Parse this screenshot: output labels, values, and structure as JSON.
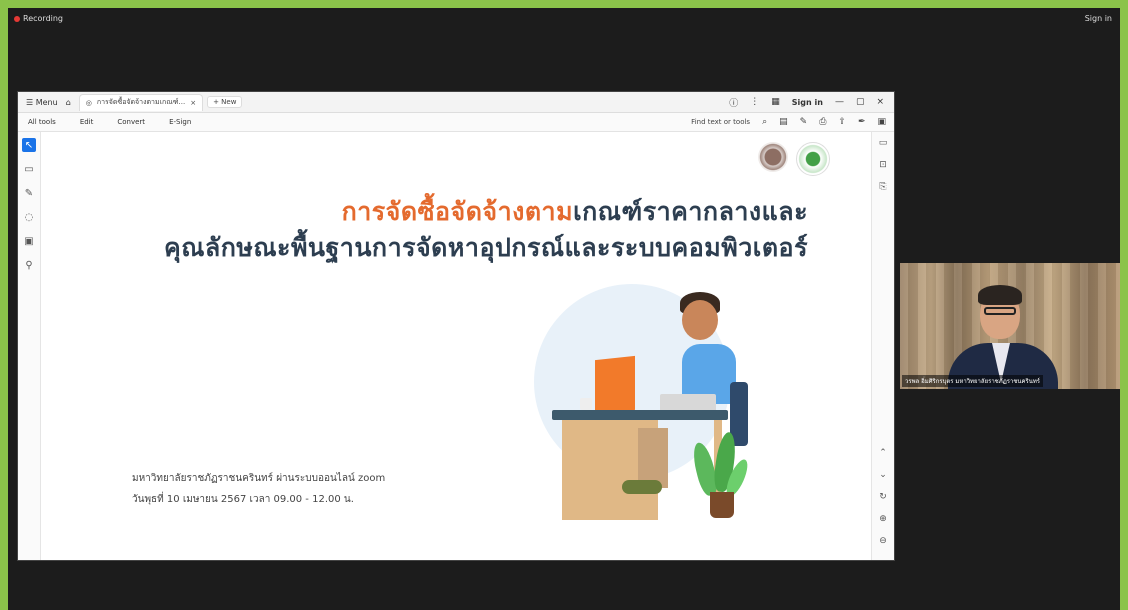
{
  "top_bar": {
    "recording": "Recording",
    "sign_in": "Sign in"
  },
  "browser": {
    "menu": "Menu",
    "tab_title": "การจัดซื้อจัดจ้างตามเกณฑ์...",
    "new_tab": "+ New",
    "sign_in": "Sign in"
  },
  "pdf_toolbar": {
    "menu_items": [
      "All tools",
      "Edit",
      "Convert",
      "E-Sign"
    ],
    "find": "Find text or tools"
  },
  "slide": {
    "title_line1_orange": "การจัดซื้อจัดจ้างตาม",
    "title_line1_dark": "เกณฑ์ราคากลางและ",
    "title_line2": "คุณลักษณะพื้นฐานการจัดหาอุปกรณ์และระบบคอมพิวเตอร์",
    "info_line1": "มหาวิทยาลัยราชภัฏราชนครินทร์ ผ่านระบบออนไลน์ zoom",
    "info_line2": "วันพุธที่ 10 เมษายน 2567 เวลา 09.00 - 12.00 น."
  },
  "participant": {
    "name": "วรพล อิ่มศิริกรบุตร มหาวิทยาลัยราชภัฏราชนครินทร์"
  },
  "colors": {
    "accent": "#8bc34a",
    "title_orange": "#e46a2e",
    "title_dark": "#2d3e50"
  }
}
